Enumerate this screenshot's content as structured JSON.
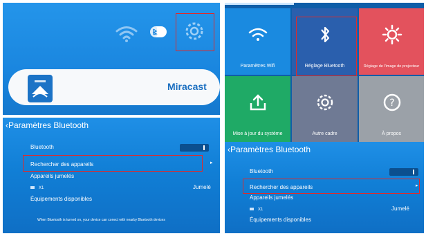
{
  "home": {
    "miracast_label": "Miracast",
    "icons": [
      "wifi-icon",
      "bluetooth-icon",
      "gear-icon",
      "miracast-icon"
    ]
  },
  "grid": {
    "tiles": [
      {
        "label": "Paramètres Wifi",
        "color": "#1a8ae0",
        "icon": "wifi-icon"
      },
      {
        "label": "Réglage  Bluetooth",
        "color": "#2a5fad",
        "icon": "bluetooth-icon"
      },
      {
        "label": "Réglage de l'image de projecteur",
        "color": "#e3525d",
        "icon": "projector-settings-icon"
      },
      {
        "label": "Mise à jour du système",
        "color": "#1faa66",
        "icon": "upload-icon"
      },
      {
        "label": "Autre cadre",
        "color": "#6f7a94",
        "icon": "gear-icon"
      },
      {
        "label": "À propos",
        "color": "#9ba1a8",
        "icon": "info-icon"
      }
    ]
  },
  "bt_left": {
    "header": "Paramètres Bluetooth",
    "bluetooth_label": "Bluetooth",
    "search_label": "Rechercher des appareils",
    "paired_label": "Appareils jumelés",
    "device_name": "X1",
    "device_status": "Jumelé",
    "available_label": "Équipements disponibles",
    "footer_note": "When Bluetooth is turned on, your device can conect with nearby Bluetooth devices"
  },
  "bt_right": {
    "header": "Paramètres Bluetooth",
    "bluetooth_label": "Bluetooth",
    "search_label": "Rechercher des appareils",
    "paired_label": "Appareils jumelés",
    "device_name": "X1",
    "device_status": "Jumelé",
    "available_label": "Équipements disponibles"
  },
  "colors": {
    "highlight_box": "#e02a2a",
    "panel_blue": "#137ed6",
    "text": "#ffffff"
  }
}
